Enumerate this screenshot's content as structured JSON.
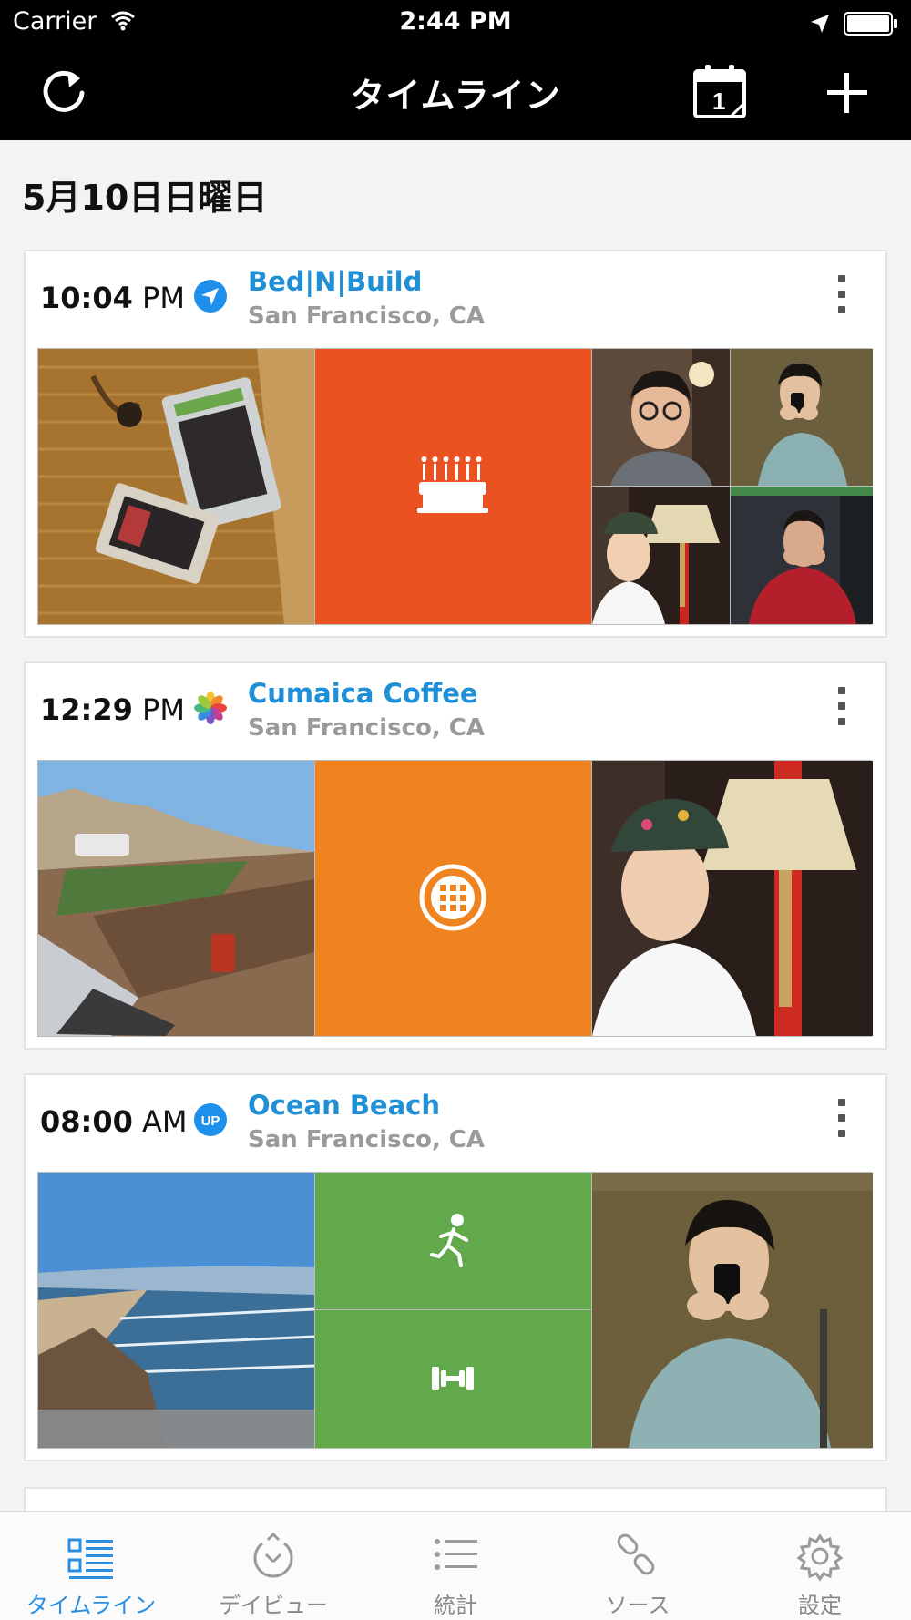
{
  "status_bar": {
    "carrier": "Carrier",
    "time": "2:44 PM"
  },
  "nav": {
    "title": "タイムライン",
    "calendar_day": "1"
  },
  "date_header": "5月10日日曜日",
  "cards": [
    {
      "time": "10:04",
      "ampm": "PM",
      "title": "Bed|N|Build",
      "subtitle": "San Francisco, CA",
      "source_icon": "location-arrow-icon",
      "accent": "#ea5221"
    },
    {
      "time": "12:29",
      "ampm": "PM",
      "title": "Cumaica Coffee",
      "subtitle": "San Francisco, CA",
      "source_icon": "photos-flower-icon",
      "accent": "#ef831f"
    },
    {
      "time": "08:00",
      "ampm": "AM",
      "title": "Ocean Beach",
      "subtitle": "San Francisco, CA",
      "source_icon": "up-badge-icon",
      "accent": "#62a94b"
    }
  ],
  "source_badge_up": "UP",
  "tabs": [
    {
      "label": "タイムライン",
      "icon": "timeline-list-icon",
      "active": true
    },
    {
      "label": "デイビュー",
      "icon": "day-view-icon",
      "active": false
    },
    {
      "label": "統計",
      "icon": "stats-list-icon",
      "active": false
    },
    {
      "label": "ソース",
      "icon": "link-icon",
      "active": false
    },
    {
      "label": "設定",
      "icon": "gear-icon",
      "active": false
    }
  ],
  "colors": {
    "link_blue": "#1f8fd6",
    "tab_active": "#2a8fe0",
    "nav_bg": "#000000"
  }
}
